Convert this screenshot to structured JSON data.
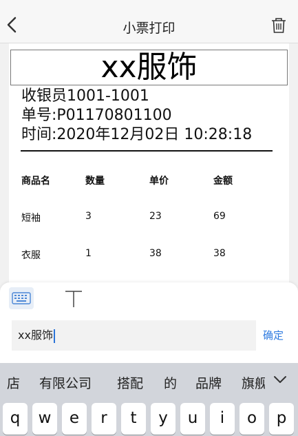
{
  "header": {
    "title": "小票打印",
    "back_icon": "chevron-left-icon",
    "delete_icon": "trash-icon"
  },
  "receipt": {
    "shop_name": "xx服饰",
    "cashier": "收银员1001-1001",
    "order_no": "单号:P01170801100",
    "time": "时间:2020年12月02日 10:28:18",
    "columns": [
      "商品名",
      "数量",
      "单价",
      "金额"
    ],
    "rows": [
      [
        "短袖",
        "3",
        "23",
        "69"
      ],
      [
        "衣服",
        "1",
        "38",
        "38"
      ]
    ]
  },
  "editor": {
    "keyboard_tool_icon": "keyboard-icon",
    "text_tool_icon": "text-icon",
    "input_value": "xx服饰",
    "confirm_label": "确定"
  },
  "keyboard": {
    "suggestions": [
      "店",
      "有限公司",
      "搭配",
      "的",
      "品牌",
      "旗舰"
    ],
    "collapse_icon": "chevron-down-icon",
    "row1": [
      "q",
      "w",
      "e",
      "r",
      "t",
      "y",
      "u",
      "i",
      "o",
      "p"
    ]
  },
  "colors": {
    "accent": "#2e7be0",
    "keyboard_bg": "#d2d5db",
    "nav_bg": "#f7f7f7"
  }
}
